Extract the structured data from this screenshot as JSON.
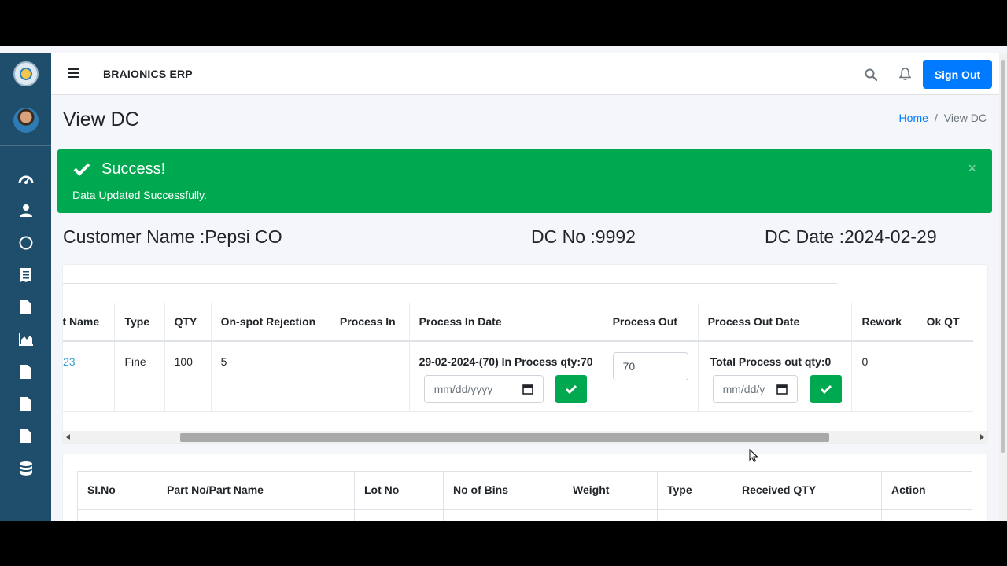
{
  "app": {
    "title": "BRAIONICS ERP",
    "sign_out": "Sign Out"
  },
  "page": {
    "title": "View DC"
  },
  "breadcrumb": {
    "home": "Home",
    "separator": "/",
    "current": "View DC"
  },
  "alert": {
    "title": "Success!",
    "message": "Data Updated Successfully.",
    "close": "×",
    "color": "#00a84f"
  },
  "dc": {
    "customer": "Customer Name :Pepsi CO",
    "dc_no": "DC No :9992",
    "dc_date": "DC Date :2024-02-29"
  },
  "process_table": {
    "headers": [
      "rt Name",
      "Type",
      "QTY",
      "On-spot Rejection",
      "Process In",
      "Process In Date",
      "Process Out",
      "Process Out Date",
      "Rework",
      "Ok QT"
    ],
    "row": {
      "part_name": "23",
      "type": "Fine",
      "qty": "100",
      "rejection": "5",
      "process_in": "",
      "process_in_date_label": "29-02-2024-(70) In Process qty:70",
      "process_in_date_placeholder": "mm/dd/yyyy",
      "process_out": "70",
      "process_out_date_label": "Total Process out qty:0",
      "process_out_date_placeholder": "mm/dd/y",
      "rework": "0",
      "ok_qty": ""
    }
  },
  "received_table": {
    "headers": [
      "SI.No",
      "Part No/Part Name",
      "Lot No",
      "No of Bins",
      "Weight",
      "Type",
      "Received QTY",
      "Action"
    ]
  },
  "colors": {
    "sidebar": "#1e4e6b",
    "primary": "#007bff",
    "success": "#00a84f"
  }
}
